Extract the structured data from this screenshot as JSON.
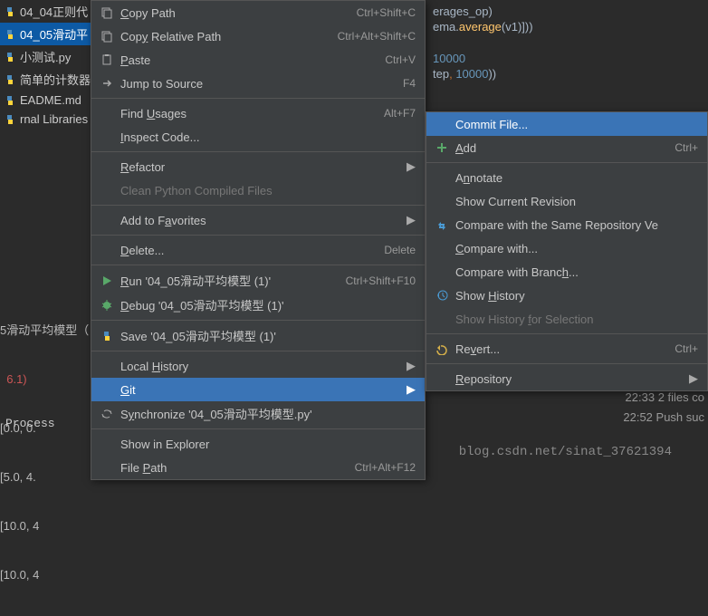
{
  "sidebar": {
    "files": [
      {
        "name": "04_04正则代",
        "sel": false
      },
      {
        "name": "04_05滑动平",
        "sel": true
      },
      {
        "name": "小测试.py",
        "sel": false
      },
      {
        "name": "简单的计数器",
        "sel": false
      },
      {
        "name": "EADME.md",
        "sel": false
      },
      {
        "name": "rnal Libraries",
        "sel": false
      }
    ]
  },
  "code": {
    "l1": "erages_op)",
    "l2a": "ema.",
    "l2b": "average",
    "l2c": "(v1)]))",
    "l3": "10000",
    "l4a": "tep",
    "l4b": ", ",
    "l4c": "10000",
    "l4d": "))"
  },
  "output": {
    "tab": "5滑动平均模型（",
    "l1": "  6.1)",
    "l2": "[0.0, 0.",
    "l3": "[5.0, 4.",
    "l4": "[10.0, 4",
    "l5": "[10.0, 4"
  },
  "process": "Process",
  "menu1": [
    {
      "t": "item",
      "icon": "copy",
      "label": "<u>C</u>opy Path",
      "short": "Ctrl+Shift+C"
    },
    {
      "t": "item",
      "icon": "copy",
      "label": "Cop<u>y</u> Relative Path",
      "short": "Ctrl+Alt+Shift+C"
    },
    {
      "t": "item",
      "icon": "paste",
      "label": "<u>P</u>aste",
      "short": "Ctrl+V"
    },
    {
      "t": "item",
      "icon": "jump",
      "label": "Jump to Source",
      "short": "F4"
    },
    {
      "t": "sep"
    },
    {
      "t": "item",
      "label": "Find <u>U</u>sages",
      "short": "Alt+F7"
    },
    {
      "t": "item",
      "label": "<u>I</u>nspect Code..."
    },
    {
      "t": "sep"
    },
    {
      "t": "item",
      "label": "<u>R</u>efactor",
      "sub": true
    },
    {
      "t": "item",
      "label": "Clean Python Compiled Files",
      "disabled": true
    },
    {
      "t": "sep"
    },
    {
      "t": "item",
      "label": "Add to F<u>a</u>vorites",
      "sub": true
    },
    {
      "t": "sep"
    },
    {
      "t": "item",
      "label": "<u>D</u>elete...",
      "short": "Delete"
    },
    {
      "t": "sep"
    },
    {
      "t": "item",
      "icon": "run",
      "label": "<u>R</u>un '04_05滑动平均模型 (1)'",
      "short": "Ctrl+Shift+F10"
    },
    {
      "t": "item",
      "icon": "debug",
      "label": "<u>D</u>ebug '04_05滑动平均模型 (1)'"
    },
    {
      "t": "sep"
    },
    {
      "t": "item",
      "icon": "python",
      "label": "Save '04_05滑动平均模型 (1)'"
    },
    {
      "t": "sep"
    },
    {
      "t": "item",
      "label": "Local <u>H</u>istory",
      "sub": true
    },
    {
      "t": "item",
      "label": "<u>G</u>it",
      "sub": true,
      "hl": true
    },
    {
      "t": "item",
      "icon": "sync",
      "label": "S<u>y</u>nchronize '04_05滑动平均模型.py'"
    },
    {
      "t": "sep"
    },
    {
      "t": "item",
      "label": "Show in Explorer"
    },
    {
      "t": "item",
      "label": "File <u>P</u>ath",
      "short": "Ctrl+Alt+F12"
    }
  ],
  "menu2": [
    {
      "t": "item",
      "label": "Commit File...",
      "hl": true
    },
    {
      "t": "item",
      "icon": "add",
      "label": "<u>A</u>dd",
      "short": "Ctrl+"
    },
    {
      "t": "sep"
    },
    {
      "t": "item",
      "label": "A<u>n</u>notate"
    },
    {
      "t": "item",
      "label": "Show Current Revision"
    },
    {
      "t": "item",
      "icon": "compare",
      "label": "Compare with the Same Repository Ve"
    },
    {
      "t": "item",
      "label": "<u>C</u>ompare with..."
    },
    {
      "t": "item",
      "label": "Compare with Branc<u>h</u>..."
    },
    {
      "t": "item",
      "icon": "history",
      "label": "Show <u>H</u>istory"
    },
    {
      "t": "item",
      "label": "Show History <u>f</u>or Selection",
      "disabled": true
    },
    {
      "t": "sep"
    },
    {
      "t": "item",
      "icon": "revert",
      "label": "Re<u>v</u>ert...",
      "short": "Ctrl+"
    },
    {
      "t": "sep"
    },
    {
      "t": "item",
      "label": "<u>R</u>epository",
      "sub": true
    }
  ],
  "status": {
    "l1": "22:33  2 files co",
    "l2": "22:52  Push suc"
  },
  "watermark": "blog.csdn.net/sinat_37621394"
}
